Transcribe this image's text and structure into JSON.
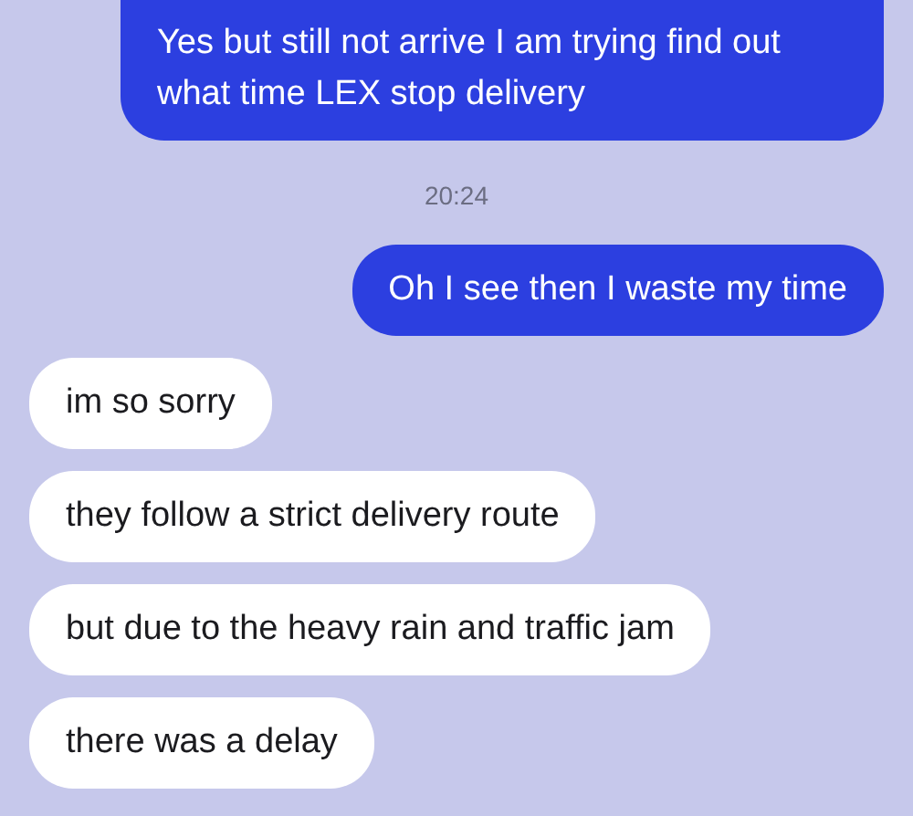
{
  "messages": [
    {
      "kind": "sent",
      "text": "Yes but still not arrive I am trying find out what time LEX stop delivery"
    },
    {
      "kind": "timestamp",
      "text": "20:24"
    },
    {
      "kind": "sent",
      "text": "Oh I see then I waste my time"
    },
    {
      "kind": "received",
      "text": "im so sorry"
    },
    {
      "kind": "received",
      "text": "they follow a strict delivery route"
    },
    {
      "kind": "received",
      "text": "but due to the heavy rain and traffic jam"
    },
    {
      "kind": "received",
      "text": "there was a delay"
    }
  ]
}
